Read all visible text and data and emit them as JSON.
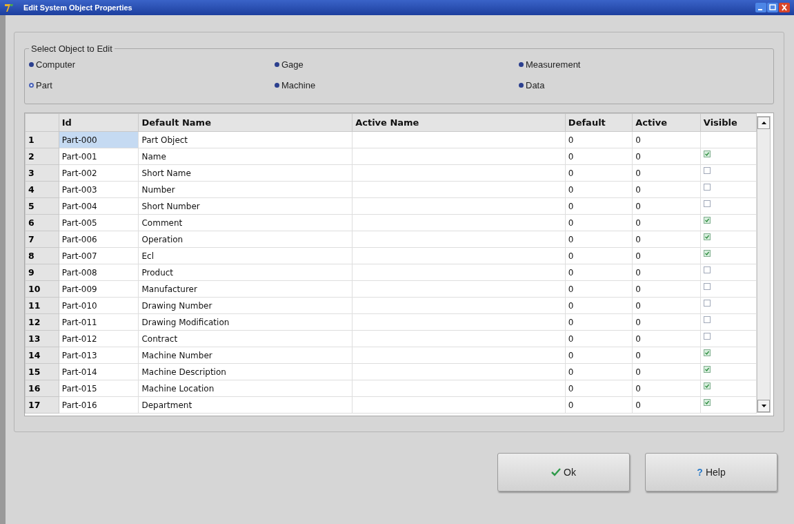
{
  "window": {
    "title": "Edit System Object Properties"
  },
  "object_group": {
    "title": "Select Object to Edit",
    "options": [
      {
        "label": "Computer",
        "selected": false
      },
      {
        "label": "Gage",
        "selected": false
      },
      {
        "label": "Measurement",
        "selected": false
      },
      {
        "label": "Part",
        "selected": true
      },
      {
        "label": "Machine",
        "selected": false
      },
      {
        "label": "Data",
        "selected": false
      }
    ]
  },
  "table": {
    "columns": [
      "Id",
      "Default Name",
      "Active Name",
      "Default",
      "Active",
      "Visible"
    ],
    "rows": [
      {
        "number": "1",
        "id": "Part-000",
        "default_name": "Part Object",
        "default": "0",
        "active": "0",
        "id_selected": true
      },
      {
        "number": "2",
        "id": "Part-001",
        "default_name": "Name",
        "default": "0",
        "active": "0",
        "visible": true,
        "id_selected": false
      },
      {
        "number": "3",
        "id": "Part-002",
        "default_name": "Short Name",
        "default": "0",
        "active": "0",
        "visible": false,
        "id_selected": false
      },
      {
        "number": "4",
        "id": "Part-003",
        "default_name": "Number",
        "default": "0",
        "active": "0",
        "visible": false,
        "id_selected": false
      },
      {
        "number": "5",
        "id": "Part-004",
        "default_name": "Short Number",
        "default": "0",
        "active": "0",
        "visible": false,
        "id_selected": false
      },
      {
        "number": "6",
        "id": "Part-005",
        "default_name": "Comment",
        "default": "0",
        "active": "0",
        "visible": true,
        "id_selected": false
      },
      {
        "number": "7",
        "id": "Part-006",
        "default_name": "Operation",
        "default": "0",
        "active": "0",
        "visible": true,
        "id_selected": false
      },
      {
        "number": "8",
        "id": "Part-007",
        "default_name": "Ecl",
        "default": "0",
        "active": "0",
        "visible": true,
        "id_selected": false
      },
      {
        "number": "9",
        "id": "Part-008",
        "default_name": "Product",
        "default": "0",
        "active": "0",
        "visible": false,
        "id_selected": false
      },
      {
        "number": "10",
        "id": "Part-009",
        "default_name": "Manufacturer",
        "default": "0",
        "active": "0",
        "visible": false,
        "id_selected": false
      },
      {
        "number": "11",
        "id": "Part-010",
        "default_name": "Drawing Number",
        "default": "0",
        "active": "0",
        "visible": false,
        "id_selected": false
      },
      {
        "number": "12",
        "id": "Part-011",
        "default_name": "Drawing Modification",
        "default": "0",
        "active": "0",
        "visible": false,
        "id_selected": false
      },
      {
        "number": "13",
        "id": "Part-012",
        "default_name": "Contract",
        "default": "0",
        "active": "0",
        "visible": false,
        "id_selected": false
      },
      {
        "number": "14",
        "id": "Part-013",
        "default_name": "Machine Number",
        "default": "0",
        "active": "0",
        "visible": true,
        "id_selected": false
      },
      {
        "number": "15",
        "id": "Part-014",
        "default_name": "Machine Description",
        "default": "0",
        "active": "0",
        "visible": true,
        "id_selected": false
      },
      {
        "number": "16",
        "id": "Part-015",
        "default_name": "Machine Location",
        "default": "0",
        "active": "0",
        "visible": true,
        "id_selected": false
      },
      {
        "number": "17",
        "id": "Part-016",
        "default_name": "Department",
        "default": "0",
        "active": "0",
        "visible": true,
        "id_selected": false
      }
    ]
  },
  "buttons": [
    {
      "kind": "ok",
      "label": "Ok"
    },
    {
      "kind": "help",
      "label": "Help",
      "icon": "?"
    }
  ]
}
